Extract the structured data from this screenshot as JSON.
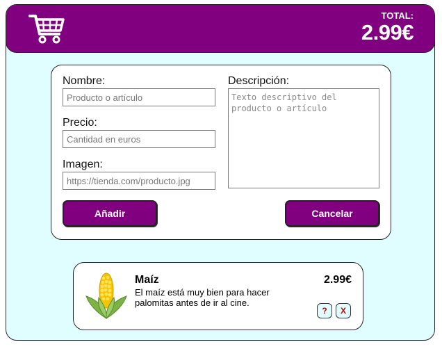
{
  "header": {
    "total_label": "TOTAL:",
    "total_value": "2.99€",
    "cart_icon": "shopping-cart-icon"
  },
  "form": {
    "nombre_label": "Nombre:",
    "nombre_placeholder": "Producto o artículo",
    "precio_label": "Precio:",
    "precio_placeholder": "Cantidad en euros",
    "imagen_label": "Imagen:",
    "imagen_placeholder": "https://tienda.com/producto.jpg",
    "descripcion_label": "Descripción:",
    "descripcion_placeholder": "Texto descriptivo del producto o artículo",
    "add_label": "Añadir",
    "cancel_label": "Cancelar"
  },
  "products": [
    {
      "name": "Maíz",
      "description": "El maíz está muy bien para hacer palomitas antes de ir al cine.",
      "price": "2.99€",
      "image_icon": "corn-icon",
      "info_label": "?",
      "delete_label": "X"
    }
  ],
  "colors": {
    "accent": "#800080",
    "background": "#e0fdff",
    "delete_red": "#c00000"
  }
}
